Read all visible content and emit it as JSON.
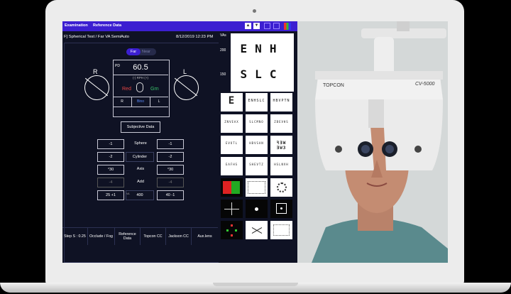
{
  "topbar": {
    "tabs": [
      "Examination",
      "Reference Data"
    ],
    "up_arrow": "▲",
    "down_arrow": "▼"
  },
  "header": {
    "test_title": "F] Spherical Test / Far VA SemiAuto",
    "datetime": "8/12/2019 12:23 PM"
  },
  "distance": {
    "far": "Far",
    "near": "Near",
    "selected": "Far"
  },
  "pd": {
    "label": "PD",
    "value": "60.5",
    "rph_label": "(-) RPH (+)",
    "red": "Red",
    "green": "Grn",
    "segments": [
      "R",
      "Bino",
      "L"
    ]
  },
  "eyes": {
    "right": "R",
    "left": "L"
  },
  "subjective_button": "Subjective Data",
  "rows": [
    {
      "label": "Sphere",
      "right": "-1",
      "left": "-1",
      "dim": false
    },
    {
      "label": "Cylinder",
      "right": "-2",
      "left": "-2",
      "dim": false
    },
    {
      "label": "Axis",
      "right": "°30",
      "left": "°30",
      "dim": false
    },
    {
      "label": "Add",
      "right": "-4",
      "left": "-4",
      "dim": true
    },
    {
      "label": "400",
      "right": "25 +1",
      "left": "40 -1",
      "dim": false
    }
  ],
  "va_small": "VA",
  "bottom_bar": [
    "Step S : 0.25",
    "Occlude / Fog",
    "Reference Data",
    "Topcon CC",
    "Jackson CC",
    "Aux.lens"
  ],
  "chart": {
    "va_header": "VAs",
    "va_values": [
      "200",
      "150"
    ],
    "line1": "ENH",
    "line2": "SLC"
  },
  "thumbnails": [
    [
      "E",
      "ENHSLC",
      "HBVPTN"
    ],
    [
      "ZNVEAX",
      "SLCMNO",
      "ZBEVHS"
    ],
    [
      "EVOTL",
      "HBVSAN",
      "ꟻƎW ƎWЗ"
    ],
    [
      "EAFHS",
      "SHEVTZ",
      "HSLNVH"
    ]
  ],
  "photo_labels": {
    "brand": "TOPCON",
    "model": "CV-5000"
  },
  "colors": {
    "accent": "#3c1fd1",
    "panel_bg": "#0f1224",
    "red": "#e84545",
    "green": "#39c56b",
    "bino": "#5b8cff"
  }
}
